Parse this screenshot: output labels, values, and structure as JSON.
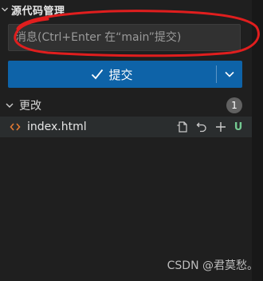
{
  "header": {
    "title": "源代码管理"
  },
  "message": {
    "placeholder": "消息(Ctrl+Enter 在“main”提交)",
    "value": ""
  },
  "commit": {
    "label": "提交"
  },
  "changes": {
    "label": "更改",
    "count": "1",
    "files": [
      {
        "name": "index.html",
        "status": "U"
      }
    ]
  },
  "watermark": "CSDN @君莫愁。",
  "colors": {
    "background": "#1f1f1f",
    "button": "#0e63a8",
    "untracked": "#73c991",
    "annotation": "#e01e1e"
  },
  "icons": {
    "section-chevron": "chevron-down-icon",
    "commit": "check-icon",
    "commit-dropdown": "chevron-down-icon",
    "file": "html-file-icon",
    "open-file": "open-file-icon",
    "discard": "discard-changes-icon",
    "stage": "plus-icon"
  }
}
